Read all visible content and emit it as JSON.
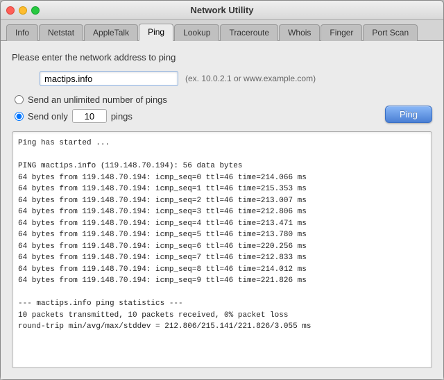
{
  "window": {
    "title": "Network Utility"
  },
  "tabs": [
    {
      "id": "info",
      "label": "Info",
      "active": false
    },
    {
      "id": "netstat",
      "label": "Netstat",
      "active": false
    },
    {
      "id": "appletalk",
      "label": "AppleTalk",
      "active": false
    },
    {
      "id": "ping",
      "label": "Ping",
      "active": true
    },
    {
      "id": "lookup",
      "label": "Lookup",
      "active": false
    },
    {
      "id": "traceroute",
      "label": "Traceroute",
      "active": false
    },
    {
      "id": "whois",
      "label": "Whois",
      "active": false
    },
    {
      "id": "finger",
      "label": "Finger",
      "active": false
    },
    {
      "id": "portscan",
      "label": "Port Scan",
      "active": false
    }
  ],
  "ping_section": {
    "prompt": "Please enter the network address to ping",
    "address_value": "mactips.info",
    "address_placeholder": "mactips.info",
    "address_hint": "(ex. 10.0.2.1 or www.example.com)",
    "radio_unlimited_label": "Send an unlimited number of pings",
    "radio_count_prefix": "Send only",
    "radio_count_value": "10",
    "radio_count_suffix": "pings",
    "ping_button_label": "Ping",
    "output": "Ping has started ...\n\nPING mactips.info (119.148.70.194): 56 data bytes\n64 bytes from 119.148.70.194: icmp_seq=0 ttl=46 time=214.066 ms\n64 bytes from 119.148.70.194: icmp_seq=1 ttl=46 time=215.353 ms\n64 bytes from 119.148.70.194: icmp_seq=2 ttl=46 time=213.007 ms\n64 bytes from 119.148.70.194: icmp_seq=3 ttl=46 time=212.806 ms\n64 bytes from 119.148.70.194: icmp_seq=4 ttl=46 time=213.471 ms\n64 bytes from 119.148.70.194: icmp_seq=5 ttl=46 time=213.780 ms\n64 bytes from 119.148.70.194: icmp_seq=6 ttl=46 time=220.256 ms\n64 bytes from 119.148.70.194: icmp_seq=7 ttl=46 time=212.833 ms\n64 bytes from 119.148.70.194: icmp_seq=8 ttl=46 time=214.012 ms\n64 bytes from 119.148.70.194: icmp_seq=9 ttl=46 time=221.826 ms\n\n--- mactips.info ping statistics ---\n10 packets transmitted, 10 packets received, 0% packet loss\nround-trip min/avg/max/stddev = 212.806/215.141/221.826/3.055 ms"
  },
  "traffic_lights": {
    "close_title": "Close",
    "minimize_title": "Minimize",
    "maximize_title": "Maximize"
  }
}
